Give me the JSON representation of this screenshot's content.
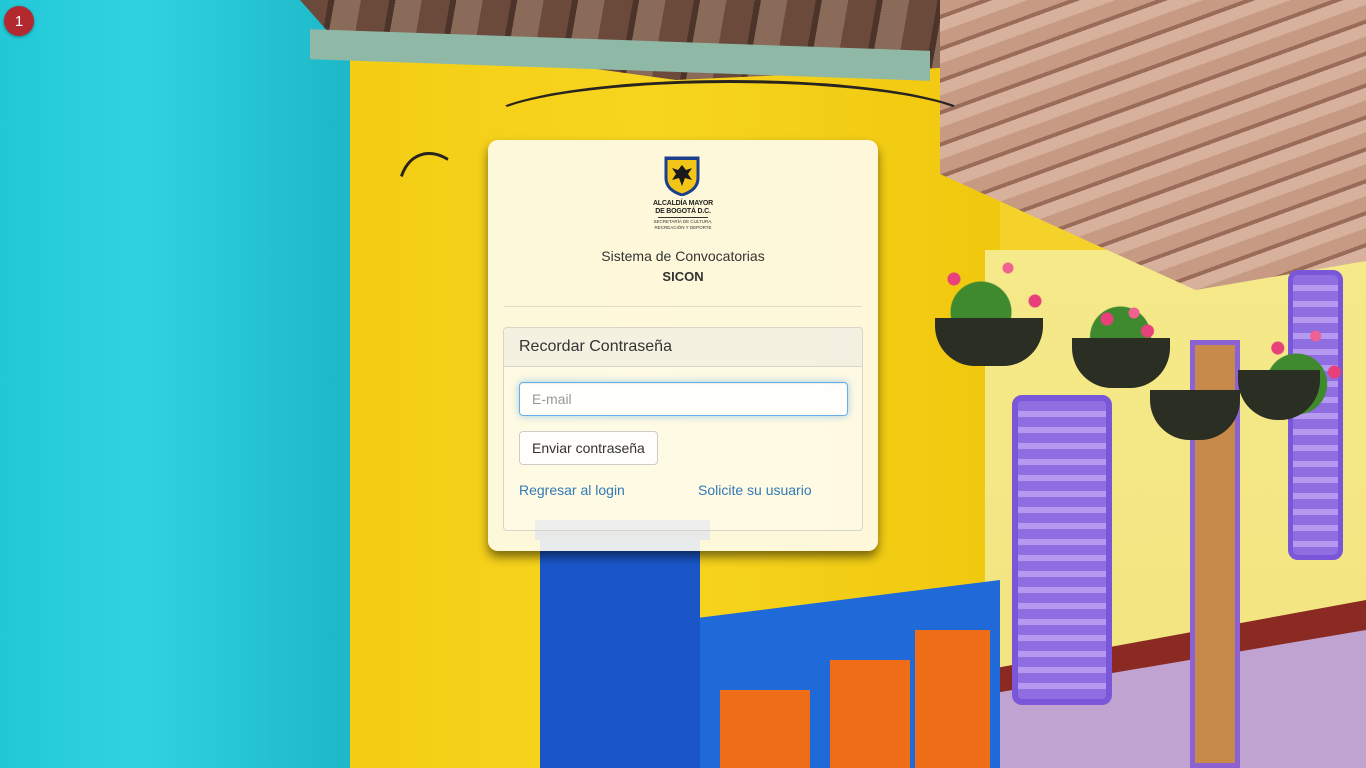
{
  "step_badge": "1",
  "logo": {
    "line1": "ALCALDÍA MAYOR",
    "line2": "DE BOGOTÁ D.C.",
    "line3": "SECRETARÍA DE CULTURA,",
    "line4": "RECREACIÓN Y DEPORTE",
    "icon": "bogota-shield-icon"
  },
  "system": {
    "name": "Sistema de Convocatorias",
    "code": "SICON"
  },
  "form": {
    "heading": "Recordar Contraseña",
    "email_placeholder": "E-mail",
    "email_value": "",
    "submit_label": "Enviar contraseña",
    "back_link": "Regresar al login",
    "request_link": "Solicite su usuario"
  },
  "colors": {
    "link": "#337ab7",
    "badge": "#b22a2f",
    "focus_border": "#66afe9"
  }
}
